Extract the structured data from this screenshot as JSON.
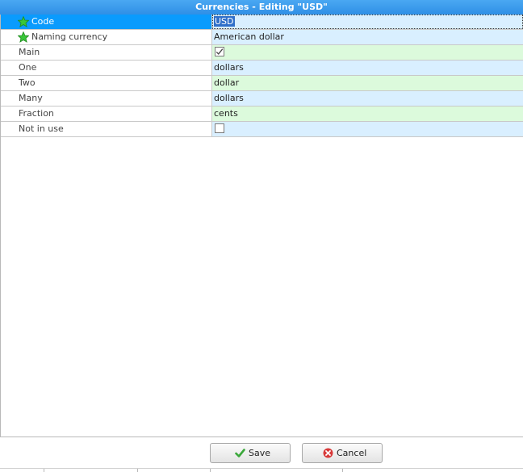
{
  "window": {
    "title": "Currencies - Editing \"USD\""
  },
  "properties": [
    {
      "label": "Code",
      "value": "USD",
      "required": true,
      "selected": true,
      "type": "text",
      "bg": "blue"
    },
    {
      "label": "Naming currency",
      "value": "American dollar",
      "required": true,
      "selected": false,
      "type": "text",
      "bg": "blue"
    },
    {
      "label": "Main",
      "value": "",
      "checked": true,
      "required": false,
      "selected": false,
      "type": "checkbox",
      "bg": "green"
    },
    {
      "label": "One",
      "value": "dollars",
      "required": false,
      "selected": false,
      "type": "text",
      "bg": "blue"
    },
    {
      "label": "Two",
      "value": "dollar",
      "required": false,
      "selected": false,
      "type": "text",
      "bg": "green"
    },
    {
      "label": "Many",
      "value": "dollars",
      "required": false,
      "selected": false,
      "type": "text",
      "bg": "blue"
    },
    {
      "label": "Fraction",
      "value": "cents",
      "required": false,
      "selected": false,
      "type": "text",
      "bg": "green"
    },
    {
      "label": "Not in use",
      "value": "",
      "checked": false,
      "required": false,
      "selected": false,
      "type": "checkbox",
      "bg": "blue"
    }
  ],
  "buttons": {
    "save_label": "Save",
    "cancel_label": "Cancel"
  },
  "icons": {
    "required": "green-star-icon",
    "save": "green-checkmark-icon",
    "cancel": "red-x-circle-icon"
  },
  "colors": {
    "title_bar": "#2f8fe6",
    "selected_row": "#0a9bfd",
    "value_blue": "#d9efff",
    "value_green": "#dcfadc"
  }
}
